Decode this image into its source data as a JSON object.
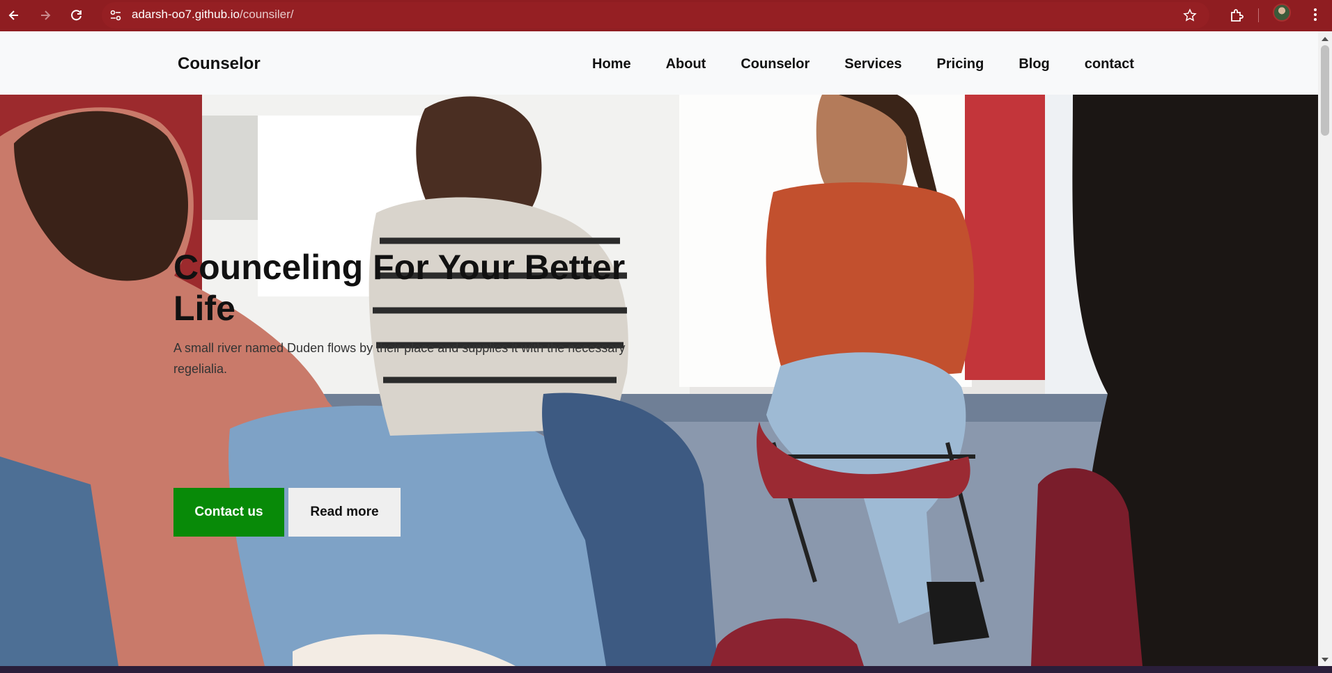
{
  "browser": {
    "url_host": "adarsh-oo7.github.io",
    "url_path": "/counsiler/",
    "icons": [
      "back-icon",
      "forward-icon",
      "reload-icon",
      "site-info-icon",
      "star-icon",
      "extensions-icon",
      "profile-avatar",
      "menu-icon"
    ]
  },
  "navbar": {
    "brand": "Counselor",
    "links": [
      "Home",
      "About",
      "Counselor",
      "Services",
      "Pricing",
      "Blog",
      "contact"
    ]
  },
  "hero": {
    "title": "Counceling For Your Better Life",
    "text": "A small river named Duden flows by their place and supplies it with the necessary regelialia.",
    "primary_button": "Contact us",
    "secondary_button": "Read more"
  },
  "colors": {
    "browser_chrome": "#8f1d21",
    "primary_button": "#088a08",
    "secondary_button": "#efefef",
    "navbar_bg": "#f8f9fa"
  }
}
